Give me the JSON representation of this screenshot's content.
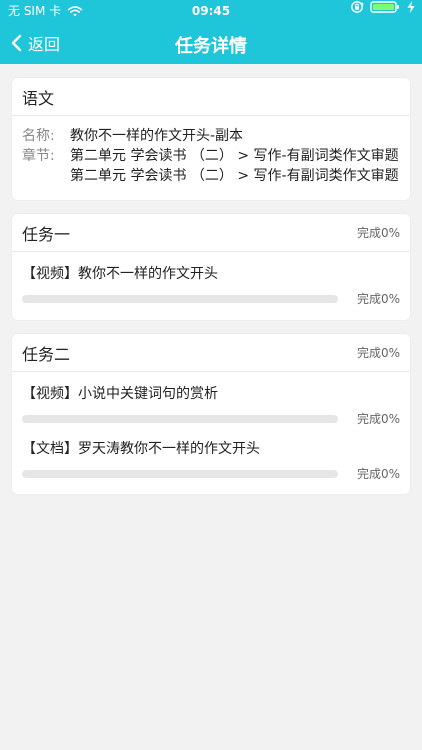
{
  "status_bar": {
    "carrier": "无 SIM 卡",
    "time": "09:45"
  },
  "nav": {
    "back_label": "返回",
    "title": "任务详情"
  },
  "subject": {
    "header": "语文",
    "name_label": "名称:",
    "name_value": "教你不一样的作文开头-副本",
    "chapter_label": "章节:",
    "chapter_lines": [
      "第二单元 学会读书 （二） > 写作-有副词类作文审题",
      "第二单元 学会读书 （二） > 写作-有副词类作文审题"
    ]
  },
  "tasks": [
    {
      "title": "任务一",
      "status": "完成0%",
      "items": [
        {
          "title": "【视频】教你不一样的作文开头",
          "progress_text": "完成0%",
          "progress_value": 0
        }
      ]
    },
    {
      "title": "任务二",
      "status": "完成0%",
      "items": [
        {
          "title": "【视频】小说中关键词句的赏析",
          "progress_text": "完成0%",
          "progress_value": 0
        },
        {
          "title": "【文档】罗天涛教你不一样的作文开头",
          "progress_text": "完成0%",
          "progress_value": 0
        }
      ]
    }
  ],
  "colors": {
    "accent": "#1fc6d9",
    "background": "#f2f2f2",
    "card": "#ffffff",
    "muted_text": "#666666"
  },
  "icons": {
    "wifi": "wifi-icon",
    "rotation_lock": "rotation-lock-icon",
    "battery": "battery-icon",
    "charging": "charging-icon",
    "back": "back-chevron-icon"
  }
}
